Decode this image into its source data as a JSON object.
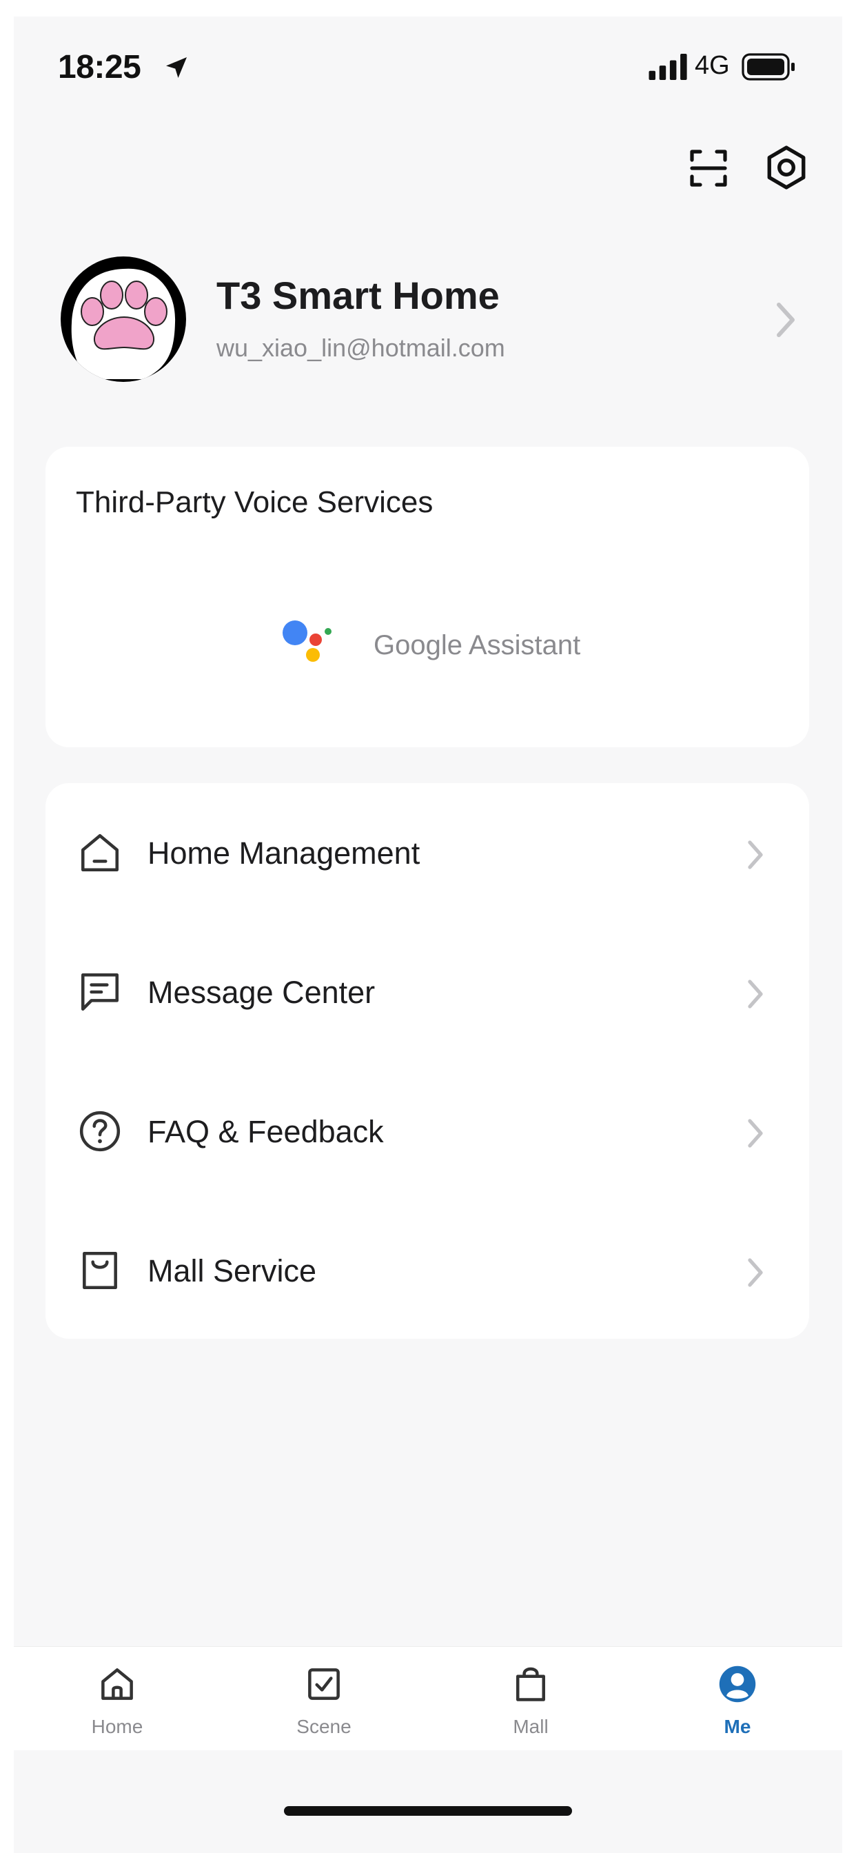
{
  "status_bar": {
    "time": "18:25",
    "network": "4G"
  },
  "top_actions": {
    "scan_icon": "scan-icon",
    "settings_icon": "settings-icon"
  },
  "profile": {
    "name": "T3 Smart Home",
    "email": "wu_xiao_lin@hotmail.com",
    "avatar_icon": "paw-icon"
  },
  "voice_services": {
    "title": "Third-Party Voice Services",
    "items": [
      {
        "label": "Google Assistant",
        "icon": "google-assistant-icon"
      }
    ]
  },
  "menu": {
    "items": [
      {
        "label": "Home Management",
        "icon": "home-icon"
      },
      {
        "label": "Message Center",
        "icon": "message-icon"
      },
      {
        "label": "FAQ & Feedback",
        "icon": "question-icon"
      },
      {
        "label": "Mall Service",
        "icon": "bag-icon"
      }
    ]
  },
  "tabbar": {
    "tabs": [
      {
        "label": "Home",
        "icon": "home-icon"
      },
      {
        "label": "Scene",
        "icon": "checkbox-icon"
      },
      {
        "label": "Mall",
        "icon": "bag-icon"
      },
      {
        "label": "Me",
        "icon": "user-icon",
        "active": true
      }
    ]
  },
  "colors": {
    "accent": "#1e6fb8",
    "background": "#f7f7f8",
    "card": "#ffffff",
    "muted_text": "#8a8a8e"
  }
}
